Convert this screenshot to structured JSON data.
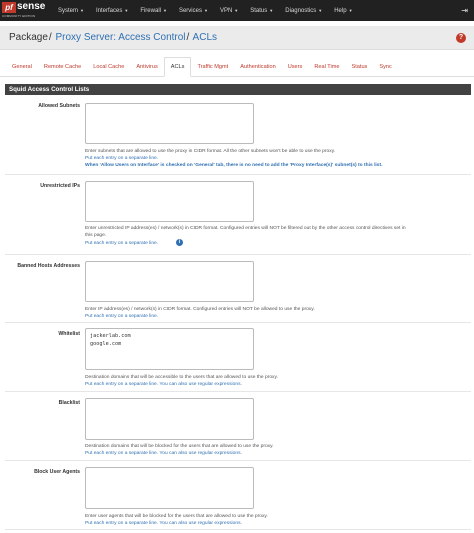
{
  "brand": {
    "logo_mark": "pf",
    "logo_word": "sense",
    "edition": "COMMUNITY EDITION"
  },
  "menu": [
    {
      "label": "System"
    },
    {
      "label": "Interfaces"
    },
    {
      "label": "Firewall"
    },
    {
      "label": "Services"
    },
    {
      "label": "VPN"
    },
    {
      "label": "Status"
    },
    {
      "label": "Diagnostics"
    },
    {
      "label": "Help"
    }
  ],
  "logout_icon": "logout-icon",
  "breadcrumb": {
    "root": "Package",
    "items": [
      "Proxy Server: Access Control",
      "ACLs"
    ],
    "separator": "/"
  },
  "help_icon": {
    "name": "help-icon",
    "glyph": "?"
  },
  "tabs": [
    {
      "label": "General"
    },
    {
      "label": "Remote Cache"
    },
    {
      "label": "Local Cache"
    },
    {
      "label": "Antivirus"
    },
    {
      "label": "ACLs"
    },
    {
      "label": "Traffic Mgmt"
    },
    {
      "label": "Authentication"
    },
    {
      "label": "Users"
    },
    {
      "label": "Real Time"
    },
    {
      "label": "Status"
    },
    {
      "label": "Sync"
    }
  ],
  "active_tab": "ACLs",
  "section_title": "Squid Access Control Lists",
  "fields": {
    "allowed_subnets": {
      "label": "Allowed Subnets",
      "value": "",
      "hint1": "Enter subnets that are allowed to use the proxy in CIDR format. All the other subnets won't be able to use the proxy.",
      "hint2": "Put each entry on a separate line.",
      "hint3": "When 'Allow Users on Interface' is checked on 'General' tab, there is no need to add the 'Proxy Interface(s)' subnet(s) to this list."
    },
    "unrestricted_ips": {
      "label": "Unrestricted IPs",
      "value": "",
      "hint1": "Enter unrestricted IP address(es) / network(s) in CIDR format. Configured entries will NOT be filtered out by the other access control directives set in",
      "hint1b": "this page.",
      "hint2": "Put each entry on a separate line.",
      "info_icon": "i"
    },
    "banned_hosts": {
      "label": "Banned Hosts Addresses",
      "value": "",
      "hint1": "Enter IP address(es) / network(s) in CIDR format. Configured entries will NOT be allowed to use the proxy.",
      "hint2": "Put each entry on a separate line."
    },
    "whitelist": {
      "label": "Whitelist",
      "value": "jackerlab.com\ngoogle.com",
      "hint1": "Destination domains that will be accessible to the users that are allowed to use the proxy.",
      "hint2": "Put each entry on a separate line. You can also use regular expressions."
    },
    "blacklist": {
      "label": "Blacklist",
      "value": "",
      "hint1": "Destination domains that will be blocked for the users that are allowed to use the proxy.",
      "hint2": "Put each entry on a separate line. You can also use regular expressions."
    },
    "block_user_agents": {
      "label": "Block User Agents",
      "value": "",
      "hint1": "Enter user agents that will be blocked for the users that are allowed to use the proxy.",
      "hint2": "Put each entry on a separate line. You can also use regular expressions."
    }
  },
  "colors": {
    "navbar": "#212121",
    "accent_red": "#c0392b",
    "link_blue": "#2f70b3",
    "panel_header": "#424242"
  }
}
